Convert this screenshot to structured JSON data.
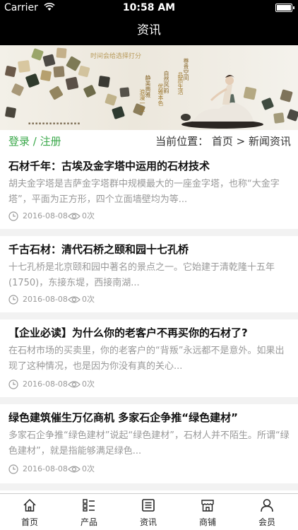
{
  "status": {
    "carrier": "Carrier",
    "time": "10:58 AM"
  },
  "navbar": {
    "title": "资讯"
  },
  "banner": {
    "headline": "时间会给选择打分",
    "columns": [
      "静美典雅",
      "浪漫一生",
      "自然风韵",
      "优雅本色",
      "尊贵空间",
      "品质生活"
    ]
  },
  "location": {
    "login": "登录 / 注册",
    "path": "当前位置： 首页 > 新闻资讯"
  },
  "articles": [
    {
      "title": "石材千年：古埃及金字塔中运用的石材技术",
      "summary": "胡夫金字塔是吉萨金字塔群中规模最大的一座金字塔，也称“大金字塔”，平面为正方形，四个立面墙壁均为等...",
      "date": "2016-08-08",
      "views": "0次"
    },
    {
      "title": "千古石材：清代石桥之颐和园十七孔桥",
      "summary": "十七孔桥是北京颐和园中著名的景点之一。它始建于清乾隆十五年(1750)，东接东堤，西接南湖...",
      "date": "2016-08-08",
      "views": "0次"
    },
    {
      "title": "【企业必读】为什么你的老客户不再买你的石材了?",
      "summary": "在石材市场的买卖里，你的老客户的“背叛”永远都不是意外。如果出现了这种情况，也是因为你没有真的关心...",
      "date": "2016-08-08",
      "views": "0次"
    },
    {
      "title": "绿色建筑催生万亿商机 多家石企争推“绿色建材”",
      "summary": "多家石企争推“绿色建材”说起“绿色建材”，石材人并不陌生。所谓“绿色建材”，就是指能够满足绿色...",
      "date": "2016-08-08",
      "views": "0次"
    }
  ],
  "tabs": [
    {
      "label": "首页",
      "icon": "home-icon"
    },
    {
      "label": "产品",
      "icon": "grid-list-icon"
    },
    {
      "label": "资讯",
      "icon": "news-icon"
    },
    {
      "label": "商铺",
      "icon": "shop-icon"
    },
    {
      "label": "会员",
      "icon": "user-icon"
    }
  ],
  "colors": {
    "accent": "#3aa84a",
    "bar": "#000000"
  }
}
